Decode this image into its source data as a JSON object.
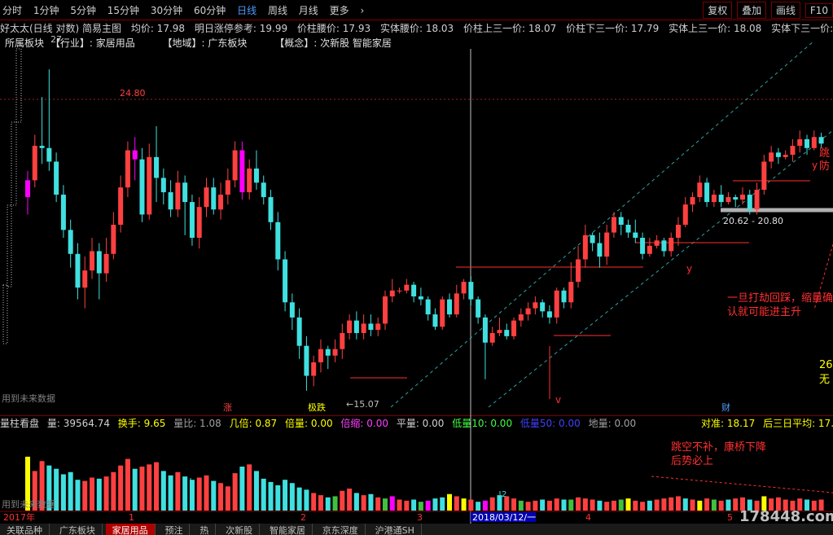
{
  "toolbar": {
    "periods": [
      "分时",
      "1分钟",
      "5分钟",
      "15分钟",
      "30分钟",
      "60分钟",
      "日线",
      "周线",
      "月线",
      "更多"
    ],
    "active_period": "日线",
    "more_chevron": "›",
    "right_buttons": [
      "复权",
      "叠加",
      "画线",
      "F10"
    ]
  },
  "info": {
    "title": "好太太(日线 对数) 简易主图",
    "avg_price": "均价: 17.98",
    "limit_ref": "明日涨停参考: 19.99",
    "pillar_waist": "价柱腰价: 17.93",
    "body_waist": "实体腰价: 18.03",
    "pillar_up3": "价柱上三一价: 18.07",
    "pillar_down3": "价柱下三一价: 17.79",
    "body_up3": "实体上三一价: 18.08",
    "body_down3": "实体下三一价: 17.99"
  },
  "sector": {
    "board": "所属板块",
    "industry": "【行业】: 家居用品",
    "region": "【地域】: 广东板块",
    "concept": "【概念】: 次新股 智能家居"
  },
  "annotations": {
    "max_label": "27.",
    "high_label": "24.80",
    "low_label": "←15.07",
    "range_label": "20.62 - 20.80",
    "future_data": "用到未来数据",
    "future_data2": "用到未来数据",
    "zhang": "涨",
    "dieting": "极跌",
    "cai": "财",
    "note1": "一旦打劫回踩，缩量确",
    "note2": "认就可能进主升",
    "note_tiao": "跳",
    "note_fang": "防",
    "note_26": "26",
    "note_wu": "无",
    "y1": "y",
    "y2": "y",
    "v1": "v",
    "vol_note1": "跳空不补，康桥下降",
    "vol_note2": "后势必上",
    "vol_mark1": "!",
    "vol_mark2": "!2",
    "watermark": "178448.com",
    "axis_labels": [
      "2017年",
      "1",
      "2",
      "3",
      "4",
      "5"
    ],
    "date_cursor": "2018/03/12/一"
  },
  "volume": {
    "title": "量柱看盘",
    "vol": "量: 39564.74",
    "turnover": "换手: 9.65",
    "ratio": "量比: 1.08",
    "times": "几倍: 0.87",
    "double": "倍量: 0.00",
    "shrink": "倍缩: 0.00",
    "flat": "平量: 0.00",
    "low10": "低量10: 0.00",
    "low50": "低量50: 0.00",
    "ground": "地量: 0.00",
    "align": "对准: 18.17",
    "avg3": "后三日平均: 17.86"
  },
  "bottom_tabs": [
    "关联品种",
    "广东板块",
    "家居用品",
    "预注",
    "热",
    "次新股",
    "智能家居",
    "京东深度",
    "沪港通SH"
  ],
  "active_bottom_tab": "家居用品",
  "colors": {
    "up": "#ff4040",
    "down": "#40e0e0",
    "accent": "#4f9bff",
    "magenta": "#ff00ff",
    "yellow": "#ffff00"
  },
  "chart_data": {
    "type": "candlestick",
    "ylim": [
      14.5,
      28.6
    ],
    "candles": [
      [
        21.7,
        22.4,
        21.0,
        22.8
      ],
      [
        22.4,
        23.9,
        22.1,
        24.4
      ],
      [
        23.9,
        23.8,
        23.1,
        26.2
      ],
      [
        23.8,
        23.2,
        22.8,
        27.6
      ],
      [
        23.2,
        21.8,
        21.5,
        23.6
      ],
      [
        21.8,
        20.4,
        20.1,
        22.2
      ],
      [
        20.4,
        19.5,
        19.0,
        20.8
      ],
      [
        19.5,
        18.3,
        17.9,
        19.9
      ],
      [
        18.3,
        18.9,
        17.6,
        19.4
      ],
      [
        18.9,
        19.6,
        18.6,
        20.1
      ],
      [
        19.6,
        18.8,
        17.9,
        19.9
      ],
      [
        18.8,
        19.5,
        18.5,
        20.1
      ],
      [
        19.5,
        20.6,
        19.3,
        21.1
      ],
      [
        20.6,
        22.1,
        20.3,
        22.6
      ],
      [
        22.1,
        23.7,
        21.7,
        24.1
      ],
      [
        23.7,
        23.3,
        22.4,
        24.3
      ],
      [
        23.3,
        21.0,
        20.7,
        23.8
      ],
      [
        21.0,
        23.4,
        20.8,
        24.0
      ],
      [
        23.4,
        22.5,
        21.5,
        24.8
      ],
      [
        22.5,
        21.9,
        21.4,
        22.9
      ],
      [
        21.9,
        21.2,
        20.9,
        22.4
      ],
      [
        21.2,
        22.3,
        20.9,
        22.8
      ],
      [
        22.3,
        21.5,
        20.2,
        22.6
      ],
      [
        21.5,
        20.1,
        19.8,
        21.8
      ],
      [
        20.1,
        21.3,
        19.7,
        21.7
      ],
      [
        21.3,
        22.1,
        20.9,
        22.5
      ],
      [
        22.1,
        21.2,
        21.0,
        22.5
      ],
      [
        21.2,
        21.8,
        20.8,
        22.3
      ],
      [
        21.8,
        22.4,
        21.4,
        22.9
      ],
      [
        22.4,
        23.7,
        22.1,
        24.1
      ],
      [
        23.7,
        21.9,
        21.6,
        24.1
      ],
      [
        21.9,
        22.9,
        21.6,
        23.3
      ],
      [
        22.9,
        22.3,
        22.0,
        23.7
      ],
      [
        22.3,
        21.7,
        21.4,
        22.6
      ],
      [
        21.7,
        20.7,
        20.4,
        22.0
      ],
      [
        20.7,
        19.3,
        18.9,
        21.1
      ],
      [
        19.3,
        17.8,
        17.5,
        19.6
      ],
      [
        17.8,
        17.3,
        16.9,
        18.1
      ],
      [
        17.3,
        16.4,
        16.0,
        17.6
      ],
      [
        16.4,
        15.5,
        15.07,
        16.7
      ],
      [
        15.5,
        15.9,
        15.2,
        16.1
      ],
      [
        15.9,
        16.3,
        15.6,
        16.6
      ],
      [
        16.3,
        16.1,
        15.7,
        16.4
      ],
      [
        16.1,
        16.3,
        15.9,
        16.6
      ],
      [
        16.3,
        16.8,
        16.0,
        17.1
      ],
      [
        16.8,
        17.2,
        16.6,
        17.4
      ],
      [
        17.2,
        16.8,
        16.6,
        17.5
      ],
      [
        16.8,
        17.1,
        16.6,
        17.4
      ],
      [
        17.1,
        16.9,
        16.7,
        17.4
      ],
      [
        16.9,
        17.1,
        16.7,
        17.3
      ],
      [
        17.1,
        18.0,
        16.9,
        18.2
      ],
      [
        18.0,
        18.2,
        17.8,
        18.6
      ],
      [
        18.2,
        18.2,
        18.1,
        18.3
      ],
      [
        18.2,
        18.4,
        18.1,
        18.6
      ],
      [
        18.4,
        18.0,
        17.8,
        18.5
      ],
      [
        18.0,
        17.9,
        17.7,
        18.3
      ],
      [
        17.9,
        17.4,
        17.2,
        18.0
      ],
      [
        17.4,
        17.0,
        16.9,
        17.6
      ],
      [
        17.0,
        17.9,
        16.9,
        18.0
      ],
      [
        17.9,
        17.4,
        17.3,
        18.1
      ],
      [
        17.4,
        18.1,
        17.3,
        18.4
      ],
      [
        18.1,
        18.5,
        17.9,
        18.6
      ],
      [
        18.5,
        17.9,
        17.7,
        18.7
      ],
      [
        17.9,
        17.3,
        17.1,
        18.0
      ],
      [
        17.3,
        16.5,
        15.4,
        17.4
      ],
      [
        16.5,
        16.8,
        16.4,
        17.0
      ],
      [
        16.8,
        16.9,
        16.7,
        17.3
      ],
      [
        16.9,
        16.7,
        16.6,
        17.1
      ],
      [
        16.7,
        17.2,
        16.6,
        17.3
      ],
      [
        17.2,
        17.4,
        17.0,
        17.6
      ],
      [
        17.4,
        17.6,
        17.2,
        17.8
      ],
      [
        17.6,
        17.8,
        17.4,
        18.0
      ],
      [
        17.8,
        17.5,
        17.3,
        17.9
      ],
      [
        17.5,
        17.3,
        17.1,
        17.7
      ],
      [
        17.3,
        18.2,
        17.1,
        18.3
      ],
      [
        18.2,
        17.8,
        17.6,
        18.3
      ],
      [
        17.8,
        18.5,
        17.6,
        19.2
      ],
      [
        18.5,
        19.3,
        18.3,
        19.8
      ],
      [
        19.3,
        20.2,
        19.0,
        20.6
      ],
      [
        20.2,
        19.9,
        19.6,
        20.3
      ],
      [
        19.9,
        19.4,
        19.0,
        20.3
      ],
      [
        19.4,
        20.3,
        19.1,
        20.6
      ],
      [
        20.3,
        20.9,
        20.1,
        21.1
      ],
      [
        20.9,
        20.6,
        20.2,
        21.1
      ],
      [
        20.6,
        20.3,
        20.1,
        20.8
      ],
      [
        20.3,
        20.1,
        19.9,
        20.8
      ],
      [
        20.1,
        19.5,
        19.3,
        20.3
      ],
      [
        19.5,
        19.8,
        19.4,
        20.1
      ],
      [
        19.8,
        20.0,
        19.7,
        20.2
      ],
      [
        20.0,
        19.6,
        19.4,
        20.1
      ],
      [
        19.6,
        20.1,
        19.4,
        20.3
      ],
      [
        20.1,
        20.6,
        19.8,
        20.9
      ],
      [
        20.6,
        21.4,
        20.5,
        21.7
      ],
      [
        21.4,
        21.7,
        21.1,
        21.9
      ],
      [
        21.7,
        22.3,
        21.5,
        22.6
      ],
      [
        22.3,
        21.5,
        21.3,
        22.5
      ],
      [
        21.5,
        21.8,
        21.3,
        22.0
      ],
      [
        21.8,
        21.5,
        21.3,
        22.2
      ],
      [
        21.5,
        21.7,
        21.4,
        21.9
      ],
      [
        21.7,
        21.6,
        21.3,
        21.8
      ],
      [
        21.6,
        21.8,
        21.4,
        22.1
      ],
      [
        21.8,
        21.2,
        21.0,
        22.0
      ],
      [
        21.2,
        22.0,
        21.0,
        22.3
      ],
      [
        22.0,
        23.2,
        21.8,
        23.5
      ],
      [
        23.2,
        23.6,
        22.9,
        23.9
      ],
      [
        23.6,
        23.4,
        23.1,
        23.8
      ],
      [
        23.4,
        23.5,
        23.3,
        23.7
      ],
      [
        23.5,
        23.9,
        23.2,
        24.2
      ],
      [
        23.9,
        24.2,
        23.6,
        24.6
      ],
      [
        24.2,
        23.8,
        23.5,
        24.4
      ],
      [
        23.8,
        24.3,
        23.7,
        24.6
      ],
      [
        24.3,
        24.0,
        23.8,
        24.5
      ]
    ],
    "volumes": [
      [
        49,
        "y"
      ],
      [
        36,
        "u"
      ],
      [
        45,
        "u"
      ],
      [
        41,
        "d"
      ],
      [
        38,
        "d"
      ],
      [
        33,
        "d"
      ],
      [
        35,
        "d"
      ],
      [
        28,
        "d"
      ],
      [
        27,
        "u"
      ],
      [
        30,
        "u"
      ],
      [
        29,
        "d"
      ],
      [
        31,
        "u"
      ],
      [
        35,
        "u"
      ],
      [
        41,
        "u"
      ],
      [
        47,
        "u"
      ],
      [
        38,
        "d"
      ],
      [
        40,
        "u"
      ],
      [
        42,
        "u"
      ],
      [
        44,
        "u"
      ],
      [
        36,
        "d"
      ],
      [
        32,
        "d"
      ],
      [
        35,
        "u"
      ],
      [
        31,
        "d"
      ],
      [
        28,
        "d"
      ],
      [
        30,
        "u"
      ],
      [
        32,
        "u"
      ],
      [
        27,
        "d"
      ],
      [
        25,
        "u"
      ],
      [
        22,
        "u"
      ],
      [
        34,
        "u"
      ],
      [
        40,
        "d"
      ],
      [
        42,
        "u"
      ],
      [
        36,
        "d"
      ],
      [
        29,
        "d"
      ],
      [
        26,
        "d"
      ],
      [
        23,
        "d"
      ],
      [
        28,
        "d"
      ],
      [
        25,
        "d"
      ],
      [
        21,
        "d"
      ],
      [
        19,
        "d"
      ],
      [
        16,
        "u"
      ],
      [
        14,
        "u"
      ],
      [
        12,
        "d"
      ],
      [
        13,
        "g"
      ],
      [
        18,
        "u"
      ],
      [
        20,
        "u"
      ],
      [
        16,
        "d"
      ],
      [
        14,
        "u"
      ],
      [
        15,
        "d"
      ],
      [
        12,
        "u"
      ],
      [
        11,
        "g"
      ],
      [
        13,
        "m"
      ],
      [
        10,
        "u"
      ],
      [
        9,
        "u"
      ],
      [
        10,
        "d"
      ],
      [
        8,
        "g"
      ],
      [
        9,
        "m"
      ],
      [
        11,
        "d"
      ],
      [
        12,
        "d"
      ],
      [
        15,
        "y"
      ],
      [
        13,
        "u"
      ],
      [
        11,
        "y"
      ],
      [
        10,
        "u"
      ],
      [
        8,
        "d"
      ],
      [
        9,
        "m"
      ],
      [
        12,
        "u"
      ],
      [
        14,
        "d"
      ],
      [
        13,
        "u"
      ],
      [
        11,
        "u"
      ],
      [
        9,
        "g"
      ],
      [
        8,
        "u"
      ],
      [
        9,
        "u"
      ],
      [
        10,
        "d"
      ],
      [
        9,
        "u"
      ],
      [
        11,
        "u"
      ],
      [
        10,
        "d"
      ],
      [
        10,
        "g"
      ],
      [
        12,
        "u"
      ],
      [
        11,
        "u"
      ],
      [
        10,
        "u"
      ],
      [
        9,
        "d"
      ],
      [
        8,
        "u"
      ],
      [
        9,
        "u"
      ],
      [
        10,
        "g"
      ],
      [
        11,
        "y"
      ],
      [
        9,
        "u"
      ],
      [
        8,
        "u"
      ],
      [
        9,
        "d"
      ],
      [
        10,
        "u"
      ],
      [
        11,
        "u"
      ],
      [
        12,
        "u"
      ],
      [
        13,
        "u"
      ],
      [
        11,
        "d"
      ],
      [
        10,
        "u"
      ],
      [
        9,
        "y"
      ],
      [
        11,
        "u"
      ],
      [
        10,
        "g"
      ],
      [
        9,
        "u"
      ],
      [
        10,
        "d"
      ],
      [
        11,
        "u"
      ],
      [
        12,
        "u"
      ],
      [
        10,
        "d"
      ],
      [
        9,
        "u"
      ],
      [
        13,
        "y"
      ],
      [
        11,
        "u"
      ],
      [
        12,
        "u"
      ],
      [
        10,
        "u"
      ],
      [
        9,
        "u"
      ],
      [
        11,
        "u"
      ],
      [
        10,
        "d"
      ],
      [
        9,
        "u"
      ],
      [
        10,
        "u"
      ]
    ]
  }
}
